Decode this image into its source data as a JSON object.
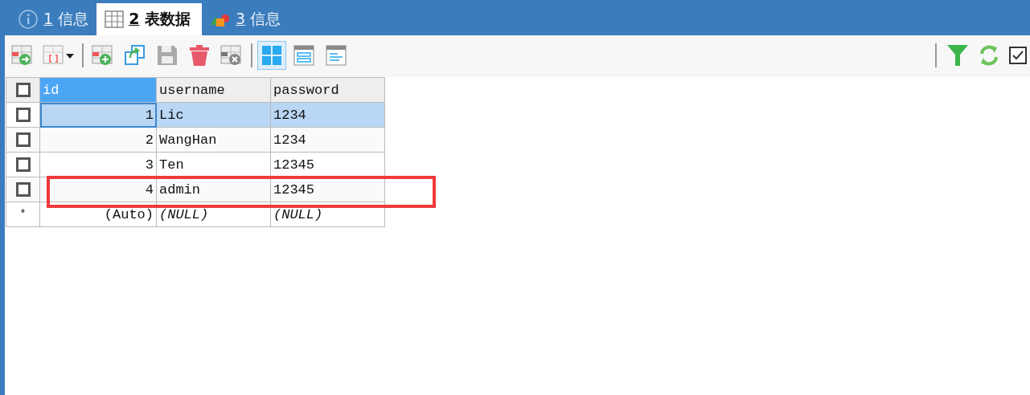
{
  "tabs": [
    {
      "key": "1",
      "label": "信息",
      "kind": "info",
      "selected": false
    },
    {
      "key": "2",
      "label": "表数据",
      "kind": "table",
      "selected": true
    },
    {
      "key": "3",
      "label": "信息",
      "kind": "shapes",
      "selected": false
    }
  ],
  "toolbar": {
    "left": [
      {
        "kind": "import",
        "selected": false
      },
      {
        "kind": "export",
        "selected": false
      },
      {
        "kind": "separator"
      },
      {
        "kind": "add-row",
        "selected": false
      },
      {
        "kind": "duplicate",
        "selected": false
      },
      {
        "kind": "save",
        "selected": false
      },
      {
        "kind": "delete",
        "selected": false
      },
      {
        "kind": "clear",
        "selected": false
      },
      {
        "kind": "separator"
      },
      {
        "kind": "grid-view",
        "selected": true
      },
      {
        "kind": "form-view",
        "selected": false
      },
      {
        "kind": "text-view",
        "selected": false
      }
    ],
    "right": [
      {
        "kind": "filter"
      },
      {
        "kind": "refresh"
      },
      {
        "kind": "checkbox",
        "checked": true
      }
    ]
  },
  "table": {
    "all_checked": false,
    "columns": [
      {
        "label": "id",
        "selected": true
      },
      {
        "label": "username",
        "selected": false
      },
      {
        "label": "password",
        "selected": false
      }
    ],
    "rows": [
      {
        "kind": "data",
        "selected": true,
        "checked": false,
        "highlighted": false,
        "cells": [
          "1",
          "Lic",
          "1234"
        ]
      },
      {
        "kind": "data",
        "selected": false,
        "checked": false,
        "highlighted": false,
        "cells": [
          "2",
          "WangHan",
          "1234"
        ]
      },
      {
        "kind": "data",
        "selected": false,
        "checked": false,
        "highlighted": false,
        "cells": [
          "3",
          "Ten",
          "12345"
        ]
      },
      {
        "kind": "data",
        "selected": false,
        "checked": false,
        "highlighted": true,
        "cells": [
          "4",
          "admin",
          "12345"
        ]
      },
      {
        "kind": "new",
        "marker": "*",
        "cells": [
          "(Auto)",
          "(NULL)",
          "(NULL)"
        ]
      }
    ]
  }
}
